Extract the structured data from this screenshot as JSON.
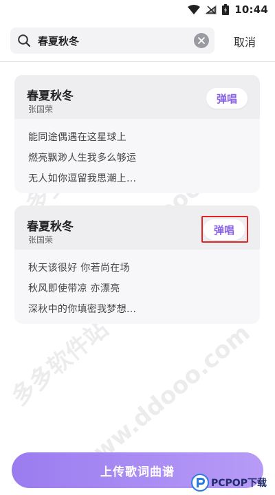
{
  "status_bar": {
    "time": "10:44"
  },
  "search": {
    "query": "春夏秋冬",
    "cancel_label": "取消"
  },
  "results": [
    {
      "title": "春夏秋冬",
      "artist": "张国荣",
      "play_label": "弹唱",
      "lyrics": [
        "能同途偶遇在这星球上",
        "燃亮飘渺人生我多么够运",
        "无人如你逗留我思潮上..."
      ]
    },
    {
      "title": "春夏秋冬",
      "artist": "张国荣",
      "play_label": "弹唱",
      "lyrics": [
        "秋天该很好 你若尚在场",
        "秋风即使带凉 亦漂亮",
        "深秋中的你填密我梦想..."
      ]
    }
  ],
  "upload_label": "上传歌词曲谱",
  "watermark": {
    "site_cn": "多多软件站",
    "site_url": "www.ddooo.com"
  },
  "logo": {
    "text": "PCPOP下载"
  },
  "colors": {
    "accent": "#8a63e6",
    "upload_gradient_start": "#9b7cf0",
    "upload_gradient_end": "#b79bf6",
    "highlight": "#e02323"
  },
  "icons": {
    "wifi": "wifi-icon",
    "signal": "signal-icon",
    "battery": "battery-icon",
    "search": "search-icon",
    "clear": "clear-icon"
  }
}
